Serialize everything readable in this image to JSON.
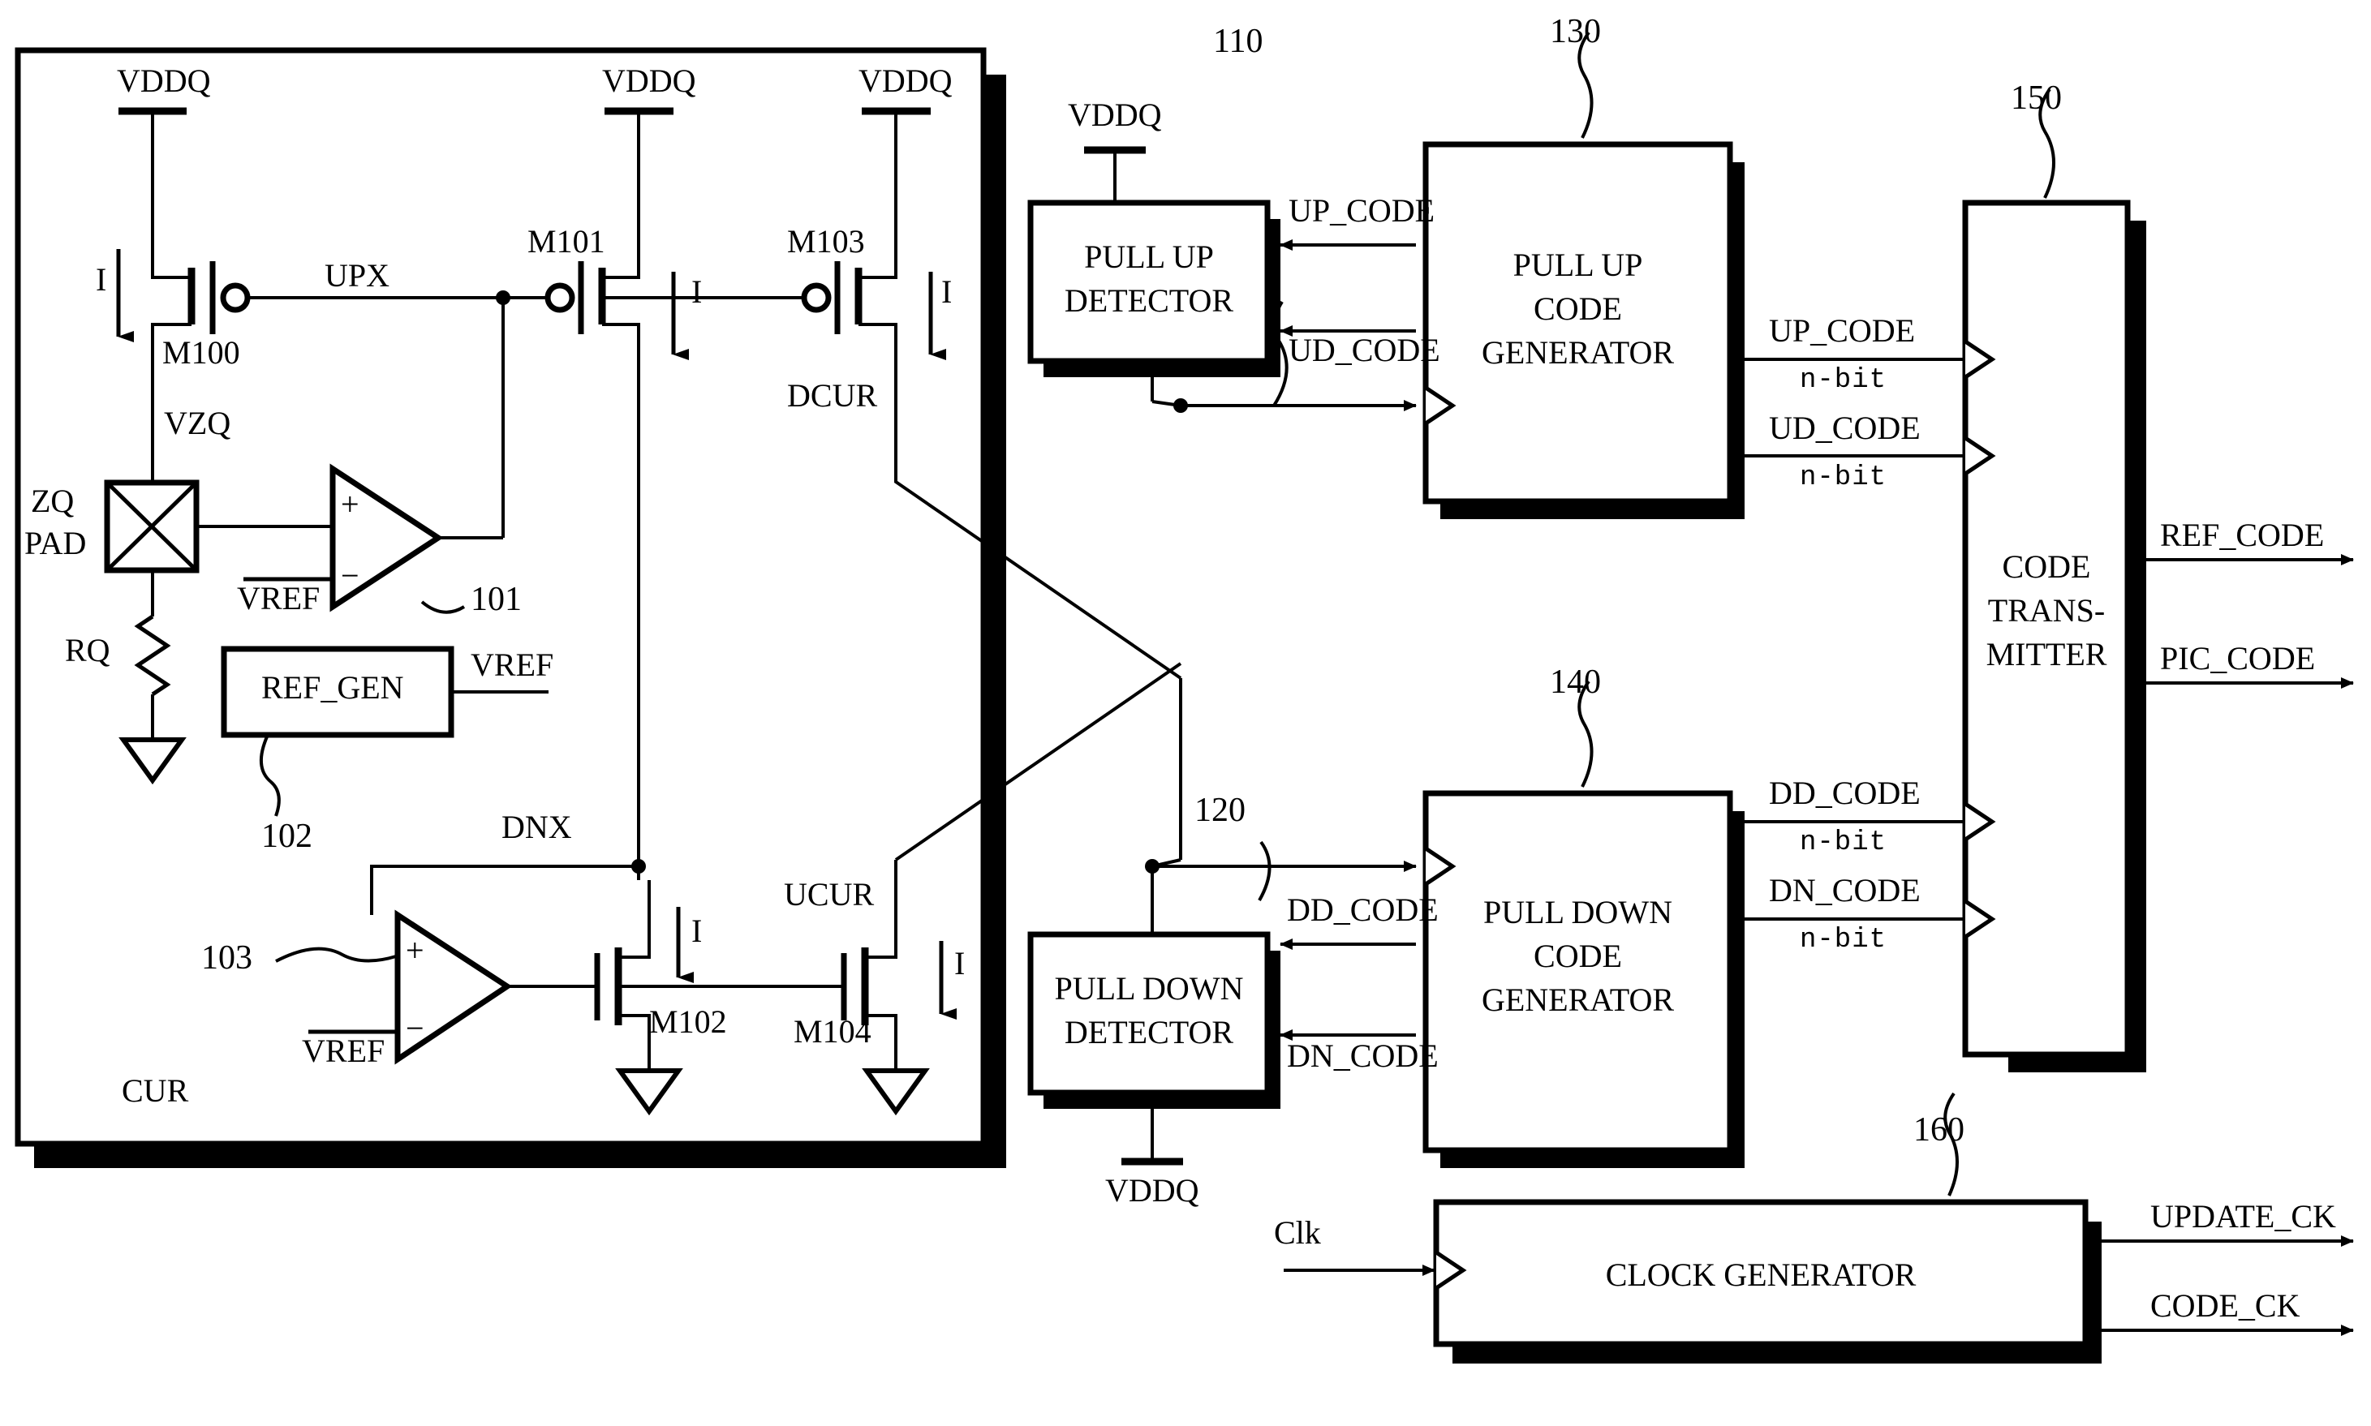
{
  "figure": {
    "type": "patent-block-diagram",
    "title": "ZQ calibration circuit block diagram"
  },
  "analog_block": {
    "name": "CUR",
    "label": "CUR",
    "supplies": [
      "VDDQ",
      "VDDQ",
      "VDDQ"
    ],
    "nets": {
      "upx": "UPX",
      "vzq": "VZQ",
      "dnx": "DNX",
      "dcur": "DCUR",
      "ucur": "UCUR"
    },
    "transistors": [
      {
        "id": "M100",
        "label": "M100"
      },
      {
        "id": "M101",
        "label": "M101"
      },
      {
        "id": "M102",
        "label": "M102"
      },
      {
        "id": "M103",
        "label": "M103"
      },
      {
        "id": "M104",
        "label": "M104"
      }
    ],
    "currents": [
      "I",
      "I",
      "I",
      "I",
      "I"
    ],
    "pad": {
      "line1": "ZQ",
      "line2": "PAD"
    },
    "resistor": "RQ",
    "comparators": [
      {
        "ref": "101",
        "plus": "+",
        "minus": "−",
        "minus_input": "VREF"
      },
      {
        "ref": "103",
        "plus": "+",
        "minus": "−",
        "minus_input": "VREF"
      }
    ],
    "ref_gen": {
      "label": "REF_GEN",
      "ref": "102",
      "output": "VREF"
    }
  },
  "blocks": [
    {
      "id": "pull-up-detector",
      "ref": "110",
      "lines": [
        "PULL UP",
        "DETECTOR"
      ],
      "supply": "VDDQ"
    },
    {
      "id": "pull-down-detector",
      "ref": "120",
      "lines": [
        "PULL DOWN",
        "DETECTOR"
      ],
      "supply": "VDDQ"
    },
    {
      "id": "pull-up-code-gen",
      "ref": "130",
      "lines": [
        "PULL UP",
        "CODE",
        "GENERATOR"
      ],
      "supply": null
    },
    {
      "id": "pull-down-code-gen",
      "ref": "140",
      "lines": [
        "PULL DOWN",
        "CODE",
        "GENERATOR"
      ],
      "supply": null
    },
    {
      "id": "code-transmitter",
      "ref": "150",
      "lines": [
        "CODE",
        "TRANS-",
        "MITTER"
      ],
      "supply": null
    },
    {
      "id": "clock-generator",
      "ref": "160",
      "lines": [
        "CLOCK GENERATOR"
      ],
      "supply": null
    }
  ],
  "signals": {
    "up_code_fb": "UP_CODE",
    "ud_code_fb": "UD_CODE",
    "dd_code_fb": "DD_CODE",
    "dn_code_fb": "DN_CODE",
    "up_code_out": "UP_CODE",
    "ud_code_out": "UD_CODE",
    "dd_code_out": "DD_CODE",
    "dn_code_out": "DN_CODE",
    "nbit_1": "n-bit",
    "nbit_2": "n-bit",
    "nbit_3": "n-bit",
    "nbit_4": "n-bit",
    "ref_code": "REF_CODE",
    "pic_code": "PIC_CODE",
    "clk_in": "Clk",
    "update_ck": "UPDATE_CK",
    "code_ck": "CODE_CK"
  },
  "colors": {
    "line": "#000000",
    "background": "#ffffff",
    "shadow": "#000000"
  }
}
